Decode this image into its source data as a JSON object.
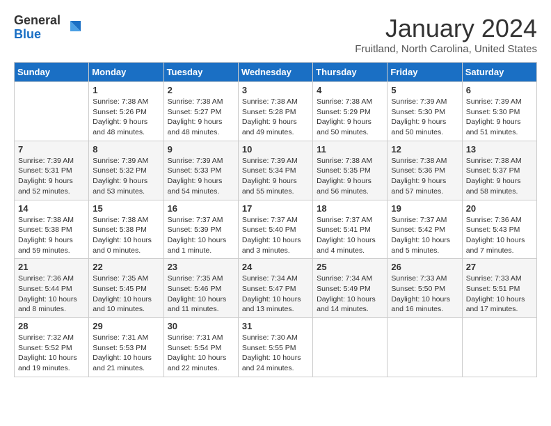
{
  "header": {
    "logo_general": "General",
    "logo_blue": "Blue",
    "title": "January 2024",
    "location": "Fruitland, North Carolina, United States"
  },
  "days_of_week": [
    "Sunday",
    "Monday",
    "Tuesday",
    "Wednesday",
    "Thursday",
    "Friday",
    "Saturday"
  ],
  "weeks": [
    [
      {
        "day": "",
        "sunrise": "",
        "sunset": "",
        "daylight": ""
      },
      {
        "day": "1",
        "sunrise": "Sunrise: 7:38 AM",
        "sunset": "Sunset: 5:26 PM",
        "daylight": "Daylight: 9 hours and 48 minutes."
      },
      {
        "day": "2",
        "sunrise": "Sunrise: 7:38 AM",
        "sunset": "Sunset: 5:27 PM",
        "daylight": "Daylight: 9 hours and 48 minutes."
      },
      {
        "day": "3",
        "sunrise": "Sunrise: 7:38 AM",
        "sunset": "Sunset: 5:28 PM",
        "daylight": "Daylight: 9 hours and 49 minutes."
      },
      {
        "day": "4",
        "sunrise": "Sunrise: 7:38 AM",
        "sunset": "Sunset: 5:29 PM",
        "daylight": "Daylight: 9 hours and 50 minutes."
      },
      {
        "day": "5",
        "sunrise": "Sunrise: 7:39 AM",
        "sunset": "Sunset: 5:30 PM",
        "daylight": "Daylight: 9 hours and 50 minutes."
      },
      {
        "day": "6",
        "sunrise": "Sunrise: 7:39 AM",
        "sunset": "Sunset: 5:30 PM",
        "daylight": "Daylight: 9 hours and 51 minutes."
      }
    ],
    [
      {
        "day": "7",
        "sunrise": "Sunrise: 7:39 AM",
        "sunset": "Sunset: 5:31 PM",
        "daylight": "Daylight: 9 hours and 52 minutes."
      },
      {
        "day": "8",
        "sunrise": "Sunrise: 7:39 AM",
        "sunset": "Sunset: 5:32 PM",
        "daylight": "Daylight: 9 hours and 53 minutes."
      },
      {
        "day": "9",
        "sunrise": "Sunrise: 7:39 AM",
        "sunset": "Sunset: 5:33 PM",
        "daylight": "Daylight: 9 hours and 54 minutes."
      },
      {
        "day": "10",
        "sunrise": "Sunrise: 7:39 AM",
        "sunset": "Sunset: 5:34 PM",
        "daylight": "Daylight: 9 hours and 55 minutes."
      },
      {
        "day": "11",
        "sunrise": "Sunrise: 7:38 AM",
        "sunset": "Sunset: 5:35 PM",
        "daylight": "Daylight: 9 hours and 56 minutes."
      },
      {
        "day": "12",
        "sunrise": "Sunrise: 7:38 AM",
        "sunset": "Sunset: 5:36 PM",
        "daylight": "Daylight: 9 hours and 57 minutes."
      },
      {
        "day": "13",
        "sunrise": "Sunrise: 7:38 AM",
        "sunset": "Sunset: 5:37 PM",
        "daylight": "Daylight: 9 hours and 58 minutes."
      }
    ],
    [
      {
        "day": "14",
        "sunrise": "Sunrise: 7:38 AM",
        "sunset": "Sunset: 5:38 PM",
        "daylight": "Daylight: 9 hours and 59 minutes."
      },
      {
        "day": "15",
        "sunrise": "Sunrise: 7:38 AM",
        "sunset": "Sunset: 5:38 PM",
        "daylight": "Daylight: 10 hours and 0 minutes."
      },
      {
        "day": "16",
        "sunrise": "Sunrise: 7:37 AM",
        "sunset": "Sunset: 5:39 PM",
        "daylight": "Daylight: 10 hours and 1 minute."
      },
      {
        "day": "17",
        "sunrise": "Sunrise: 7:37 AM",
        "sunset": "Sunset: 5:40 PM",
        "daylight": "Daylight: 10 hours and 3 minutes."
      },
      {
        "day": "18",
        "sunrise": "Sunrise: 7:37 AM",
        "sunset": "Sunset: 5:41 PM",
        "daylight": "Daylight: 10 hours and 4 minutes."
      },
      {
        "day": "19",
        "sunrise": "Sunrise: 7:37 AM",
        "sunset": "Sunset: 5:42 PM",
        "daylight": "Daylight: 10 hours and 5 minutes."
      },
      {
        "day": "20",
        "sunrise": "Sunrise: 7:36 AM",
        "sunset": "Sunset: 5:43 PM",
        "daylight": "Daylight: 10 hours and 7 minutes."
      }
    ],
    [
      {
        "day": "21",
        "sunrise": "Sunrise: 7:36 AM",
        "sunset": "Sunset: 5:44 PM",
        "daylight": "Daylight: 10 hours and 8 minutes."
      },
      {
        "day": "22",
        "sunrise": "Sunrise: 7:35 AM",
        "sunset": "Sunset: 5:45 PM",
        "daylight": "Daylight: 10 hours and 10 minutes."
      },
      {
        "day": "23",
        "sunrise": "Sunrise: 7:35 AM",
        "sunset": "Sunset: 5:46 PM",
        "daylight": "Daylight: 10 hours and 11 minutes."
      },
      {
        "day": "24",
        "sunrise": "Sunrise: 7:34 AM",
        "sunset": "Sunset: 5:47 PM",
        "daylight": "Daylight: 10 hours and 13 minutes."
      },
      {
        "day": "25",
        "sunrise": "Sunrise: 7:34 AM",
        "sunset": "Sunset: 5:49 PM",
        "daylight": "Daylight: 10 hours and 14 minutes."
      },
      {
        "day": "26",
        "sunrise": "Sunrise: 7:33 AM",
        "sunset": "Sunset: 5:50 PM",
        "daylight": "Daylight: 10 hours and 16 minutes."
      },
      {
        "day": "27",
        "sunrise": "Sunrise: 7:33 AM",
        "sunset": "Sunset: 5:51 PM",
        "daylight": "Daylight: 10 hours and 17 minutes."
      }
    ],
    [
      {
        "day": "28",
        "sunrise": "Sunrise: 7:32 AM",
        "sunset": "Sunset: 5:52 PM",
        "daylight": "Daylight: 10 hours and 19 minutes."
      },
      {
        "day": "29",
        "sunrise": "Sunrise: 7:31 AM",
        "sunset": "Sunset: 5:53 PM",
        "daylight": "Daylight: 10 hours and 21 minutes."
      },
      {
        "day": "30",
        "sunrise": "Sunrise: 7:31 AM",
        "sunset": "Sunset: 5:54 PM",
        "daylight": "Daylight: 10 hours and 22 minutes."
      },
      {
        "day": "31",
        "sunrise": "Sunrise: 7:30 AM",
        "sunset": "Sunset: 5:55 PM",
        "daylight": "Daylight: 10 hours and 24 minutes."
      },
      {
        "day": "",
        "sunrise": "",
        "sunset": "",
        "daylight": ""
      },
      {
        "day": "",
        "sunrise": "",
        "sunset": "",
        "daylight": ""
      },
      {
        "day": "",
        "sunrise": "",
        "sunset": "",
        "daylight": ""
      }
    ]
  ]
}
